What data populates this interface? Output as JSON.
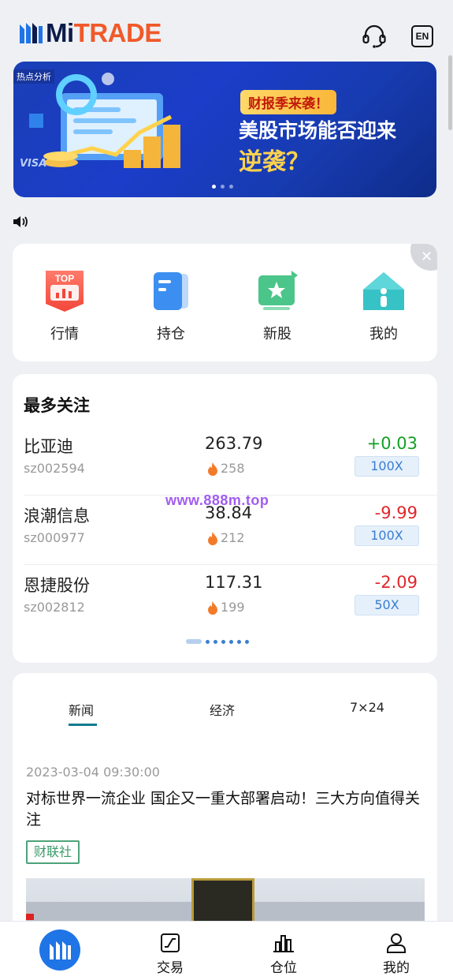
{
  "header": {
    "brand_mi": "Mi",
    "brand_trade": "TRADE",
    "lang_label": "EN"
  },
  "banner": {
    "tag": "热点分析",
    "pill": "财报季来袭！",
    "headline": "美股市场能否迎来",
    "headline2": "逆袭？",
    "illustration_text": "VISA",
    "dots": 3,
    "active_dot": 0
  },
  "shortcuts": [
    {
      "label": "行情",
      "icon": "top-chart-icon",
      "badge": "TOP"
    },
    {
      "label": "持仓",
      "icon": "folder-icon"
    },
    {
      "label": "新股",
      "icon": "tv-star-icon"
    },
    {
      "label": "我的",
      "icon": "home-icon"
    }
  ],
  "most_watched": {
    "title": "最多关注",
    "stocks": [
      {
        "name": "比亚迪",
        "code": "sz002594",
        "price": "263.79",
        "heat": "258",
        "change": "+0.03",
        "direction": "up",
        "leverage": "100X"
      },
      {
        "name": "浪潮信息",
        "code": "sz000977",
        "price": "38.84",
        "heat": "212",
        "change": "-9.99",
        "direction": "down",
        "leverage": "100X"
      },
      {
        "name": "恩捷股份",
        "code": "sz002812",
        "price": "117.31",
        "heat": "199",
        "change": "-2.09",
        "direction": "down",
        "leverage": "50X"
      }
    ],
    "pages": 7,
    "active_page": 0
  },
  "watermark": "www.888m.top",
  "news": {
    "tabs": [
      "新闻",
      "经济",
      "7×24"
    ],
    "active_tab": 0,
    "item": {
      "time": "2023-03-04 09:30:00",
      "title": "对标世界一流企业 国企又一重大部署启动！三大方向值得关注",
      "source": "财联社"
    }
  },
  "bottom_nav": [
    {
      "label": "",
      "icon": "home-logo-icon"
    },
    {
      "label": "交易",
      "icon": "trade-chart-icon"
    },
    {
      "label": "仓位",
      "icon": "bar-chart-icon"
    },
    {
      "label": "我的",
      "icon": "user-icon"
    }
  ],
  "colors": {
    "brand_blue": "#1f74e6",
    "brand_orange": "#f0592a",
    "up": "#12a024",
    "down": "#e0262c",
    "accent_teal": "#0e7b8f"
  }
}
